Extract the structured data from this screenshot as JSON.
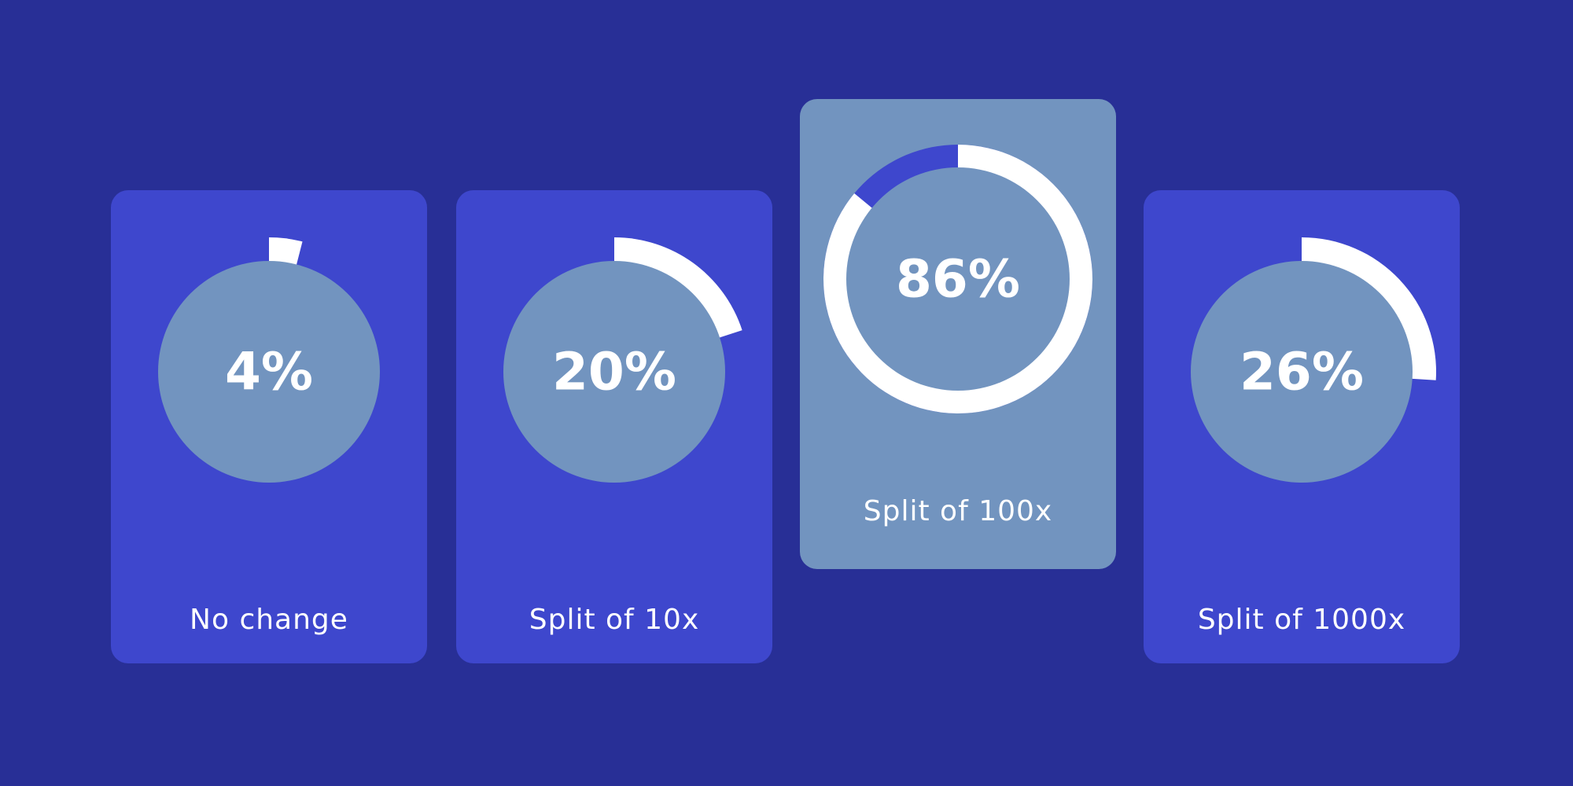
{
  "colors": {
    "background": "#282f96",
    "card": "#3e47cd",
    "card_highlight": "#7294bf",
    "inner_circle": "#7294bf",
    "arc": "#ffffff",
    "arc_track_highlight": "#3e47cd",
    "text": "#ffffff"
  },
  "chart_data": {
    "type": "pie",
    "highlighted_index": 2,
    "categories": [
      "No change",
      "Split of 10x",
      "Split of 100x",
      "Split of 1000x"
    ],
    "values": [
      4,
      20,
      86,
      26
    ],
    "value_unit": "%",
    "items": [
      {
        "label": "No change",
        "value": 4,
        "display": "4%"
      },
      {
        "label": "Split of 10x",
        "value": 20,
        "display": "20%"
      },
      {
        "label": "Split of 100x",
        "value": 86,
        "display": "86%"
      },
      {
        "label": "Split of 1000x",
        "value": 26,
        "display": "26%"
      }
    ]
  }
}
